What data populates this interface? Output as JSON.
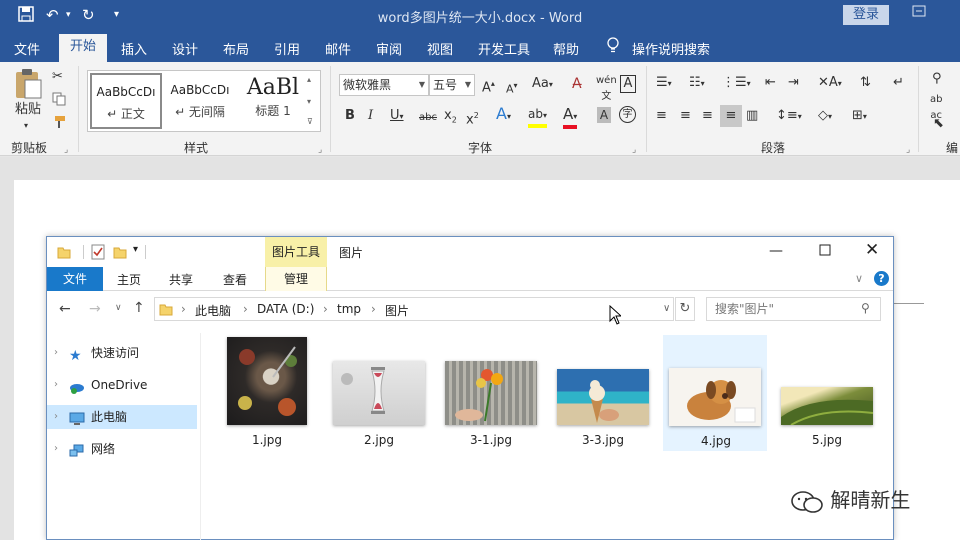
{
  "window": {
    "doc_title": "word多图片统一大小.docx  -  Word",
    "login": "登录"
  },
  "ribbon_tabs": [
    "文件",
    "开始",
    "插入",
    "设计",
    "布局",
    "引用",
    "邮件",
    "审阅",
    "视图",
    "开发工具",
    "帮助",
    "操作说明搜索"
  ],
  "ribbon": {
    "paste_label": "粘贴",
    "clipboard_group": "剪贴板",
    "styles_group": "样式",
    "font_group": "字体",
    "paragraph_group": "段落",
    "edit_group": "编",
    "styles": [
      {
        "sample": "AaBbCcDı",
        "name": "↵ 正文"
      },
      {
        "sample": "AaBbCcDı",
        "name": "↵ 无间隔"
      },
      {
        "sample": "AaBl",
        "name": "标题 1"
      }
    ],
    "font_name": "微软雅黑",
    "font_size": "五号"
  },
  "explorer": {
    "tool_context": "图片工具",
    "title": "图片",
    "tabs": [
      "文件",
      "主页",
      "共享",
      "查看",
      "管理"
    ],
    "breadcrumb": [
      "此电脑",
      "DATA (D:)",
      "tmp",
      "图片"
    ],
    "search_placeholder": "搜索\"图片\"",
    "nav": [
      "快速访问",
      "OneDrive",
      "此电脑",
      "网络"
    ],
    "files": [
      "1.jpg",
      "2.jpg",
      "3-1.jpg",
      "3-3.jpg",
      "4.jpg",
      "5.jpg"
    ]
  },
  "watermark": "解晴新生",
  "colors": {
    "word_blue": "#2b579a",
    "explorer_blue": "#1979ca",
    "picture_tools": "#f8f0a8",
    "selection": "#e5f3ff"
  }
}
